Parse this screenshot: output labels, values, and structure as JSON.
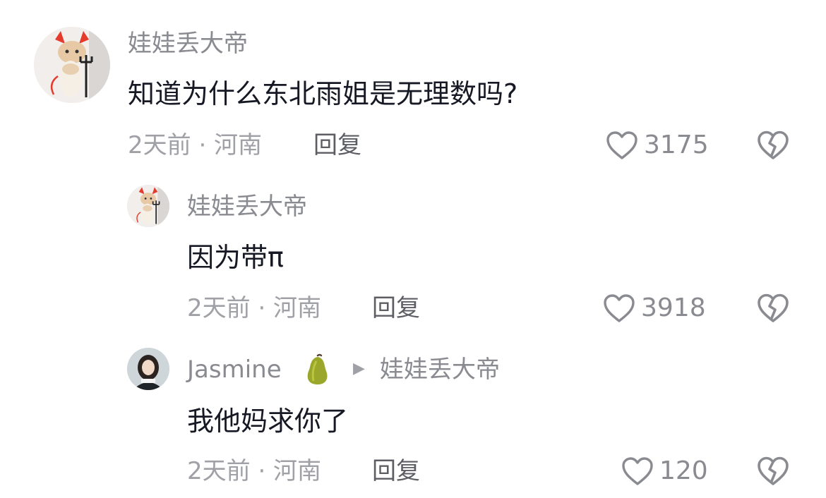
{
  "comments": [
    {
      "username": "娃娃丢大帝",
      "content": "知道为什么东北雨姐是无理数吗?",
      "time_location": "2天前 · 河南",
      "reply_label": "回复",
      "likes": "3175",
      "avatar_icon": "cat-devil-avatar"
    },
    {
      "username": "娃娃丢大帝",
      "content": "因为带π",
      "time_location": "2天前 · 河南",
      "reply_label": "回复",
      "likes": "3918",
      "avatar_icon": "cat-devil-avatar"
    },
    {
      "username": "Jasmine",
      "username_emoji": "🍐",
      "reply_to_arrow": "▶",
      "reply_to": "娃娃丢大帝",
      "content": "我他妈求你了",
      "time_location": "2天前 · 河南",
      "reply_label": "回复",
      "likes": "120",
      "avatar_icon": "girl-photo-avatar"
    }
  ],
  "icons": {
    "like": "heart-outline-icon",
    "dislike": "broken-heart-icon"
  },
  "colors": {
    "username": "#8a8b91",
    "content": "#161823",
    "meta": "#a0a1a7",
    "reply": "#5d5e64",
    "icon": "#8a8b91"
  }
}
